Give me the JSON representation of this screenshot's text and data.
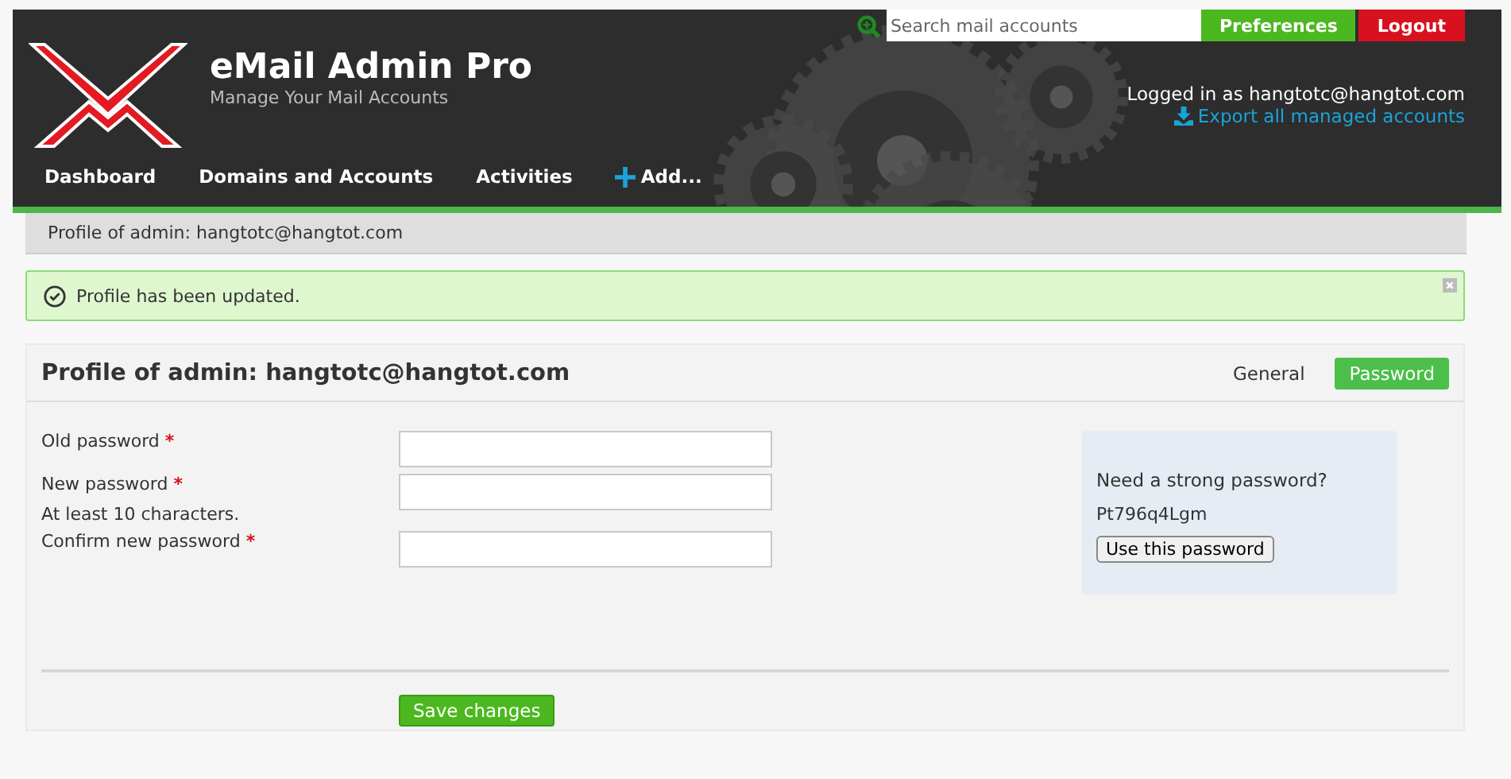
{
  "header": {
    "title": "eMail Admin Pro",
    "subtitle": "Manage Your Mail Accounts",
    "search": {
      "placeholder": "Search mail accounts"
    },
    "buttons": [
      {
        "label": "Preferences",
        "kind": "primary"
      },
      {
        "label": "Logout",
        "kind": "danger"
      }
    ],
    "logged_in": "Logged in as hangtotc@hangtot.com",
    "export_link": "Export all managed accounts",
    "nav": [
      {
        "label": "Dashboard",
        "kind": "plain"
      },
      {
        "label": "Domains and Accounts",
        "kind": "plain"
      },
      {
        "label": "Activities",
        "kind": "plain"
      },
      {
        "label": "Add...",
        "kind": "add"
      }
    ]
  },
  "breadcrumb": "Profile of admin: hangtotc@hangtot.com",
  "alert": {
    "message": "Profile has been updated."
  },
  "panel": {
    "title": "Profile of admin: hangtotc@hangtot.com",
    "tabs": [
      {
        "label": "General",
        "selected": false
      },
      {
        "label": "Password",
        "selected": true
      }
    ],
    "fields": [
      {
        "label": "Old password",
        "required": "*"
      },
      {
        "label": "New password",
        "required": "*",
        "hint": "At least 10 characters."
      },
      {
        "label": "Confirm new password",
        "required": "*"
      }
    ],
    "helper": {
      "title": "Need a strong password?",
      "password": "Pt796q4Lgm",
      "button": "Use this password"
    },
    "save": "Save changes"
  }
}
